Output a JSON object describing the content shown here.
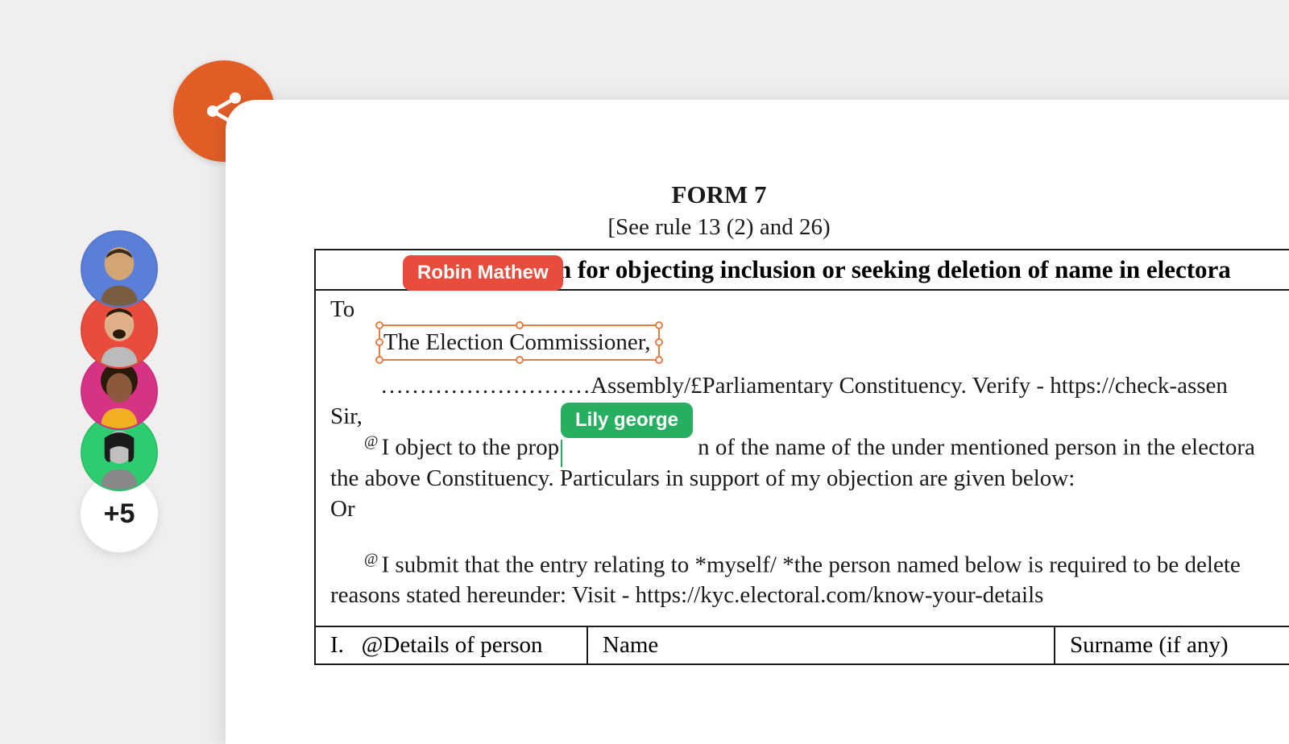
{
  "share": {
    "icon_name": "share-icon"
  },
  "collaborators": {
    "avatars": [
      "avatar-1",
      "avatar-2",
      "avatar-3",
      "avatar-4"
    ],
    "more_count": "+5"
  },
  "cursors": {
    "robin": "Robin Mathew",
    "lily": "Lily george"
  },
  "document": {
    "form_title": "FORM 7",
    "form_subtitle": "[See rule 13 (2) and 26)",
    "application_heading": "Application for objecting inclusion or seeking deletion of name in electora",
    "to_label": "To",
    "selected_recipient": "The Election Commissioner,",
    "constituency_line": "………………………Assembly/£Parliamentary Constituency. Verify - https://check-assen",
    "salutation": "Sir,",
    "objection_pre": "I object to the prop",
    "objection_post": "n of the name of the under mentioned person in the electora",
    "objection_line2": "the above Constituency. Particulars in support of my objection are given below:",
    "or_label": "Or",
    "submit_line": "I submit that the entry relating to *myself/ *the person named below is required to be delete",
    "reasons_line": "reasons stated hereunder: Visit - https://kyc.electoral.com/know-your-details",
    "details_row": {
      "col1_num": "I.",
      "col1_text": "Details of person",
      "col2": "Name",
      "col3": "Surname (if any)"
    }
  }
}
